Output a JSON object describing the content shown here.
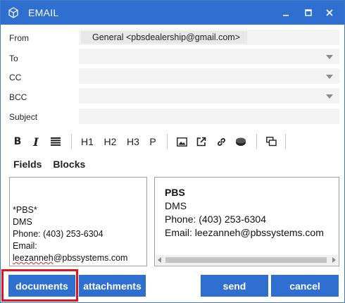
{
  "window": {
    "title": "EMAIL",
    "icons": {
      "app": "cube-icon",
      "minimize": "minimize-icon",
      "maximize": "maximize-icon",
      "close": "close-icon"
    },
    "accent_color": "#2f6fd0"
  },
  "form": {
    "from_label": "From",
    "from_value": "General  <pbsdealership@gmail.com>",
    "to_label": "To",
    "cc_label": "CC",
    "bcc_label": "BCC",
    "subject_label": "Subject",
    "to_value": "",
    "cc_value": "",
    "bcc_value": "",
    "subject_value": ""
  },
  "toolbar": {
    "bold": "B",
    "italic": "I",
    "h1": "H1",
    "h2": "H2",
    "h3": "H3",
    "p": "P"
  },
  "tabs": [
    "Fields",
    "Blocks"
  ],
  "editor": {
    "line1": "*PBS*",
    "line2": "DMS",
    "line3": "Phone: (403) 253-6304",
    "line4": "Email:",
    "email_misspelled": "leezanneh",
    "email_rest": "@pbssystems.com"
  },
  "preview": {
    "name": "PBS",
    "line2": "DMS",
    "line3": "Phone: (403) 253-6304",
    "line4": "Email: leezanneh@pbssystems.com"
  },
  "buttons": {
    "documents": "documents",
    "attachments": "attachments",
    "send": "send",
    "cancel": "cancel"
  },
  "annotation_color": "#e0141e"
}
